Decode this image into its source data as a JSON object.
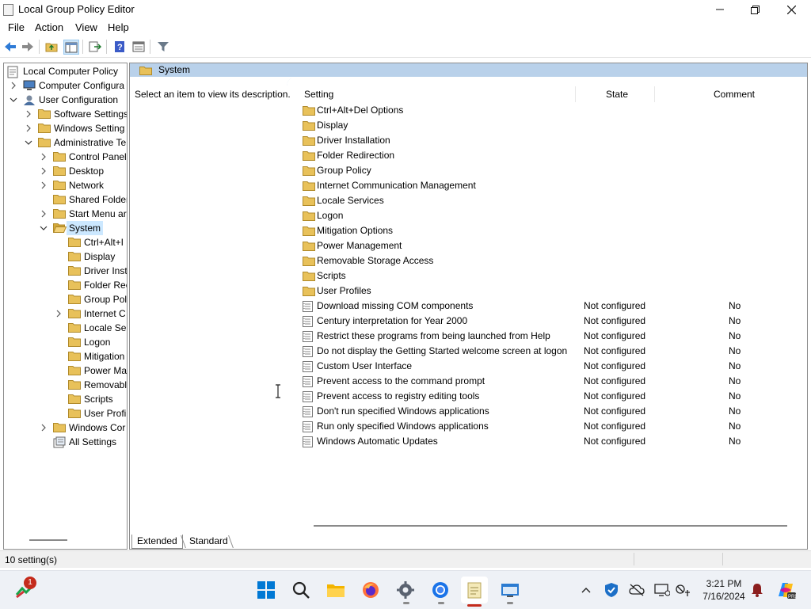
{
  "window": {
    "title": "Local Group Policy Editor"
  },
  "menu": [
    "File",
    "Action",
    "View",
    "Help"
  ],
  "tree": [
    {
      "label": "Local Computer Policy",
      "icon": "computer-policy-icon",
      "depth": 0,
      "expand": "none"
    },
    {
      "label": "Computer Configura",
      "icon": "computer-icon",
      "depth": 1,
      "expand": "collapsed"
    },
    {
      "label": "User Configuration",
      "icon": "user-icon",
      "depth": 1,
      "expand": "expanded"
    },
    {
      "label": "Software Settings",
      "icon": "folder-icon",
      "depth": 2,
      "expand": "collapsed"
    },
    {
      "label": "Windows Setting",
      "icon": "folder-icon",
      "depth": 2,
      "expand": "collapsed"
    },
    {
      "label": "Administrative Te",
      "icon": "folder-icon",
      "depth": 2,
      "expand": "expanded"
    },
    {
      "label": "Control Panel",
      "icon": "folder-icon",
      "depth": 3,
      "expand": "collapsed"
    },
    {
      "label": "Desktop",
      "icon": "folder-icon",
      "depth": 3,
      "expand": "collapsed"
    },
    {
      "label": "Network",
      "icon": "folder-icon",
      "depth": 3,
      "expand": "collapsed"
    },
    {
      "label": "Shared Folder",
      "icon": "folder-icon",
      "depth": 3,
      "expand": "none"
    },
    {
      "label": "Start Menu ar",
      "icon": "folder-icon",
      "depth": 3,
      "expand": "collapsed"
    },
    {
      "label": "System",
      "icon": "folder-open-icon",
      "depth": 3,
      "expand": "expanded",
      "selected": true
    },
    {
      "label": "Ctrl+Alt+I",
      "icon": "folder-icon",
      "depth": 4,
      "expand": "none"
    },
    {
      "label": "Display",
      "icon": "folder-icon",
      "depth": 4,
      "expand": "none"
    },
    {
      "label": "Driver Inst",
      "icon": "folder-icon",
      "depth": 4,
      "expand": "none"
    },
    {
      "label": "Folder Rec",
      "icon": "folder-icon",
      "depth": 4,
      "expand": "none"
    },
    {
      "label": "Group Pol",
      "icon": "folder-icon",
      "depth": 4,
      "expand": "none"
    },
    {
      "label": "Internet C",
      "icon": "folder-icon",
      "depth": 4,
      "expand": "collapsed"
    },
    {
      "label": "Locale Ser",
      "icon": "folder-icon",
      "depth": 4,
      "expand": "none"
    },
    {
      "label": "Logon",
      "icon": "folder-icon",
      "depth": 4,
      "expand": "none"
    },
    {
      "label": "Mitigation",
      "icon": "folder-icon",
      "depth": 4,
      "expand": "none"
    },
    {
      "label": "Power Ma",
      "icon": "folder-icon",
      "depth": 4,
      "expand": "none"
    },
    {
      "label": "Removabl",
      "icon": "folder-icon",
      "depth": 4,
      "expand": "none"
    },
    {
      "label": "Scripts",
      "icon": "folder-icon",
      "depth": 4,
      "expand": "none"
    },
    {
      "label": "User Profi",
      "icon": "folder-icon",
      "depth": 4,
      "expand": "none"
    },
    {
      "label": "Windows Cor",
      "icon": "folder-icon",
      "depth": 3,
      "expand": "collapsed"
    },
    {
      "label": "All Settings",
      "icon": "all-settings-icon",
      "depth": 3,
      "expand": "none"
    }
  ],
  "right_pane": {
    "header": "System",
    "description": "Select an item to view its description.",
    "columns": {
      "setting": "Setting",
      "state": "State",
      "comment": "Comment"
    },
    "rows": [
      {
        "name": "Ctrl+Alt+Del Options",
        "type": "folder",
        "state": "",
        "comment": ""
      },
      {
        "name": "Display",
        "type": "folder",
        "state": "",
        "comment": ""
      },
      {
        "name": "Driver Installation",
        "type": "folder",
        "state": "",
        "comment": ""
      },
      {
        "name": "Folder Redirection",
        "type": "folder",
        "state": "",
        "comment": ""
      },
      {
        "name": "Group Policy",
        "type": "folder",
        "state": "",
        "comment": ""
      },
      {
        "name": "Internet Communication Management",
        "type": "folder",
        "state": "",
        "comment": ""
      },
      {
        "name": "Locale Services",
        "type": "folder",
        "state": "",
        "comment": ""
      },
      {
        "name": "Logon",
        "type": "folder",
        "state": "",
        "comment": ""
      },
      {
        "name": "Mitigation Options",
        "type": "folder",
        "state": "",
        "comment": ""
      },
      {
        "name": "Power Management",
        "type": "folder",
        "state": "",
        "comment": ""
      },
      {
        "name": "Removable Storage Access",
        "type": "folder",
        "state": "",
        "comment": ""
      },
      {
        "name": "Scripts",
        "type": "folder",
        "state": "",
        "comment": ""
      },
      {
        "name": "User Profiles",
        "type": "folder",
        "state": "",
        "comment": ""
      },
      {
        "name": "Download missing COM components",
        "type": "setting",
        "state": "Not configured",
        "comment": "No"
      },
      {
        "name": "Century interpretation for Year 2000",
        "type": "setting",
        "state": "Not configured",
        "comment": "No"
      },
      {
        "name": "Restrict these programs from being launched from Help",
        "type": "setting",
        "state": "Not configured",
        "comment": "No"
      },
      {
        "name": "Do not display the Getting Started welcome screen at logon",
        "type": "setting",
        "state": "Not configured",
        "comment": "No"
      },
      {
        "name": "Custom User Interface",
        "type": "setting",
        "state": "Not configured",
        "comment": "No"
      },
      {
        "name": "Prevent access to the command prompt",
        "type": "setting",
        "state": "Not configured",
        "comment": "No"
      },
      {
        "name": "Prevent access to registry editing tools",
        "type": "setting",
        "state": "Not configured",
        "comment": "No"
      },
      {
        "name": "Don't run specified Windows applications",
        "type": "setting",
        "state": "Not configured",
        "comment": "No"
      },
      {
        "name": "Run only specified Windows applications",
        "type": "setting",
        "state": "Not configured",
        "comment": "No"
      },
      {
        "name": "Windows Automatic Updates",
        "type": "setting",
        "state": "Not configured",
        "comment": "No"
      }
    ]
  },
  "tabs": {
    "extended": "Extended",
    "standard": "Standard"
  },
  "status": {
    "text": "10 setting(s)"
  },
  "taskbar": {
    "badge_count": "1",
    "time": "3:21 PM",
    "date": "7/16/2024"
  },
  "colors": {
    "folder": "#e8c15a",
    "header_bg": "#b9d1ea",
    "selection": "#cce8ff",
    "accent": "#0067c0"
  }
}
